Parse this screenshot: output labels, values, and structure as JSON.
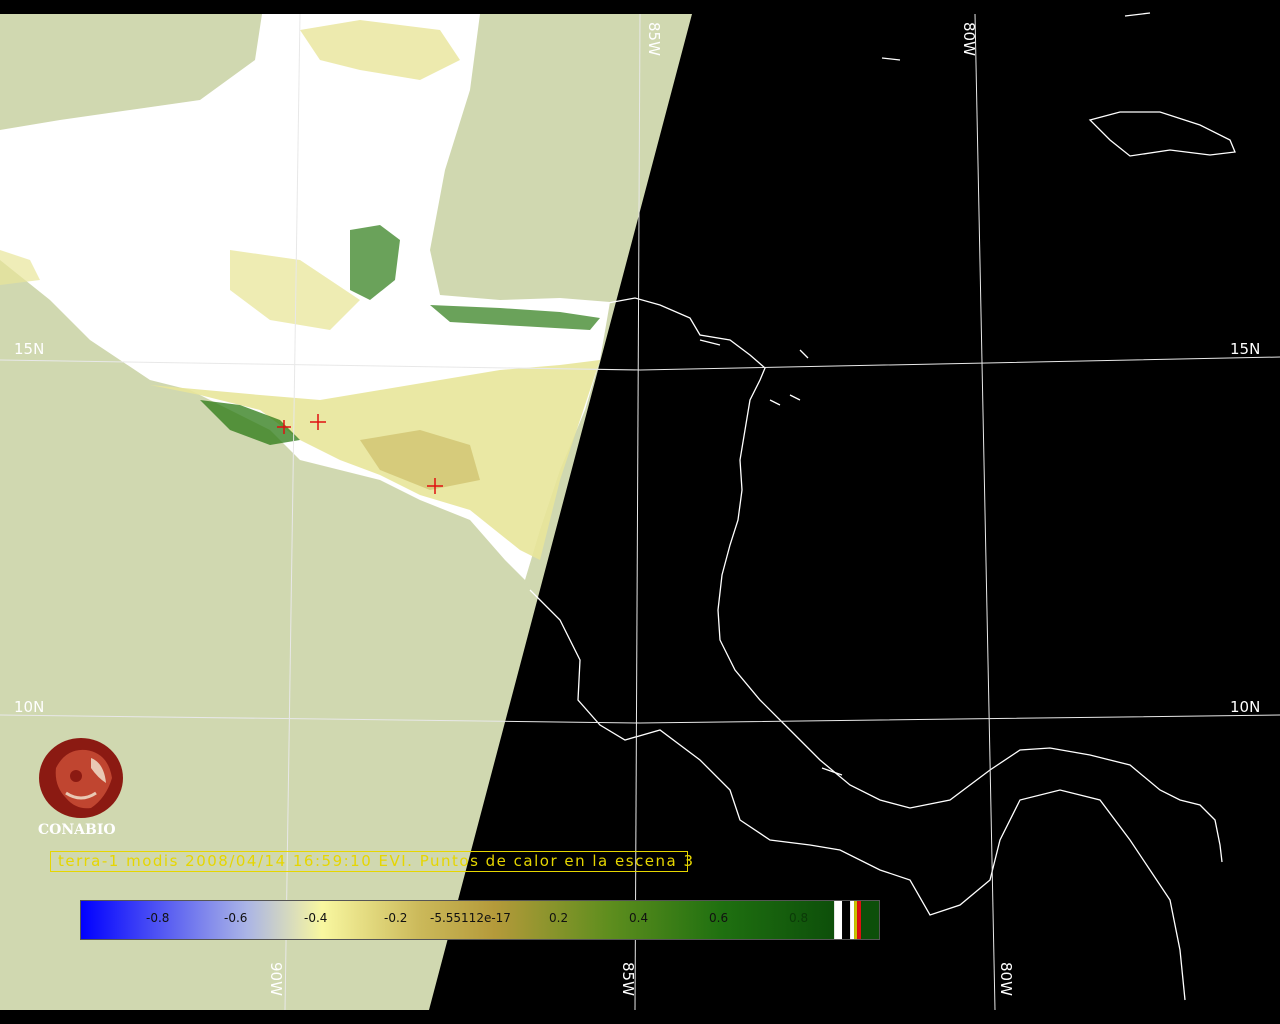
{
  "map": {
    "grid_labels": {
      "lat_15_left": "15N",
      "lat_15_right": "15N",
      "lat_10_left": "10N",
      "lat_10_right": "10N",
      "lon_85_top": "85W",
      "lon_80_top": "80W",
      "lon_90_bottom": "90W",
      "lon_85_bottom": "85W",
      "lon_80_bottom": "80W"
    },
    "colors": {
      "swath_background": "#d0d8b0",
      "cloud": "#ffffff",
      "vegetation_dark": "#1f6f10",
      "vegetation_light": "#e8e59a",
      "fire_marker": "#e01010",
      "night": "#000000",
      "coastline": "#ffffff"
    }
  },
  "logo": {
    "name": "CONABIO",
    "color": "#8b1a12"
  },
  "caption": {
    "text": "terra-1 modis 2008/04/14 16:59:10 EVI. Puntos de calor en la escena 3"
  },
  "colorbar": {
    "ticks": [
      "-0.8",
      "-0.6",
      "-0.4",
      "-0.2",
      "-5.55112e-17",
      "0.2",
      "0.4",
      "0.6",
      "0.8"
    ],
    "gradient_stops": [
      "#0000ff",
      "#aab4e6",
      "#f8f7a0",
      "#cbb95a",
      "#b49a3a",
      "#5f8e1e",
      "#1f7010",
      "#0d4f0a"
    ],
    "end_swatches": [
      "#ffffff",
      "#000000",
      "#ffffff",
      "#c9c300",
      "#e01010"
    ]
  }
}
